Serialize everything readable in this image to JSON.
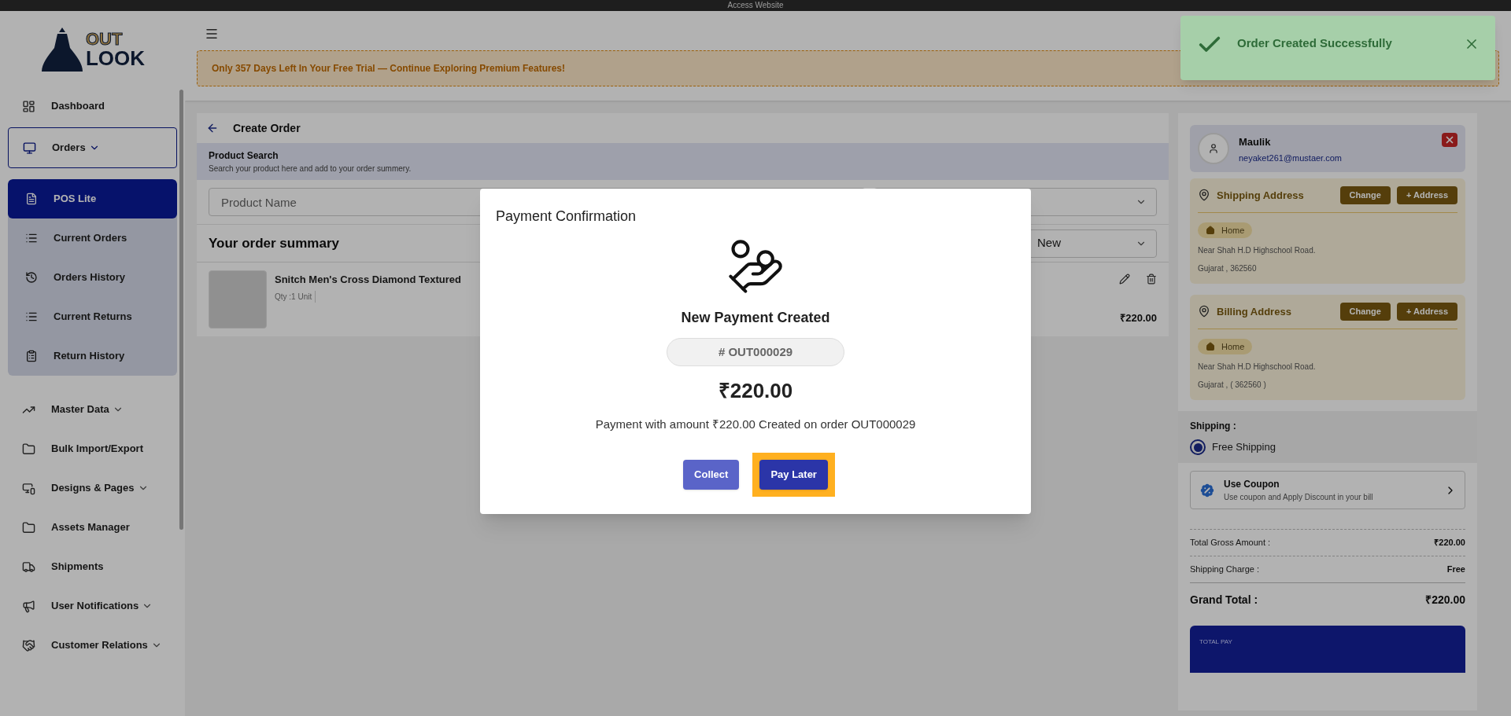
{
  "top_bar": {
    "title": "Access Website"
  },
  "sidebar": {
    "logo": {
      "line_1": "OUT",
      "line_2": "LOOK"
    },
    "items": [
      {
        "label": "Dashboard"
      },
      {
        "label": "Orders",
        "expanded": true,
        "children": [
          {
            "label": "POS Lite",
            "selected": true
          },
          {
            "label": "Current Orders",
            "selected": false
          },
          {
            "label": "Orders History",
            "selected": false
          },
          {
            "label": "Current Returns",
            "selected": false
          },
          {
            "label": "Return History",
            "selected": false
          }
        ]
      },
      {
        "label": "Master Data",
        "expanded": false
      },
      {
        "label": "Bulk Import/Export"
      },
      {
        "label": "Designs & Pages",
        "expanded": false
      },
      {
        "label": "Assets Manager"
      },
      {
        "label": "Shipments"
      },
      {
        "label": "User Notifications",
        "expanded": false
      },
      {
        "label": "Customer Relations",
        "expanded": false
      }
    ]
  },
  "banner": {
    "text": "Only 357 Days Left In Your Free Trial — Continue Exploring Premium Features!"
  },
  "toast": {
    "text": "Order Created Successfully"
  },
  "create_order": {
    "title": "Create Order",
    "product_search": {
      "title": "Product Search",
      "subtitle": "Search your product here and add to your order summery.",
      "placeholder": "Product Name"
    },
    "summary": {
      "title": "Your order summary",
      "status": "New",
      "items": [
        {
          "name": "Snitch Men's Cross Diamond Textured",
          "qty": "Qty :1 Unit",
          "price": "₹220.00"
        }
      ]
    }
  },
  "customer": {
    "name": "Maulik",
    "email": "neyaket261@mustaer.com"
  },
  "addresses": [
    {
      "title": "Shipping Address",
      "buttons": [
        "Change",
        "+ Address"
      ],
      "tag": "Home",
      "lines": [
        "Near Shah H.D Highschool Road.",
        "Gujarat , 362560"
      ]
    },
    {
      "title": "Billing Address",
      "buttons": [
        "Change",
        "+ Address"
      ],
      "tag": "Home",
      "lines": [
        "Near Shah H.D Highschool Road.",
        "Gujarat , ( 362560 )"
      ]
    }
  ],
  "shipping": {
    "label": "Shipping :",
    "options": [
      {
        "label": "Free Shipping",
        "selected": true
      }
    ]
  },
  "coupon": {
    "title": "Use Coupon",
    "subtitle": "Use coupon and Apply Discount in your bill"
  },
  "totals": {
    "rows": [
      {
        "label": "Total Gross Amount :",
        "value": "₹220.00"
      },
      {
        "label": "Shipping Charge :",
        "value": "Free"
      }
    ],
    "grand_total": {
      "label": "Grand Total :",
      "value": "₹220.00"
    },
    "total_pay": "TOTAL PAY"
  },
  "modal": {
    "title": "Payment Confirmation",
    "heading": "New Payment Created",
    "order_no": "# OUT000029",
    "amount": "₹220.00",
    "message": "Payment with amount ₹220.00 Created on order OUT000029",
    "buttons": [
      {
        "label": "Collect",
        "kind": "secondary",
        "highlighted": false
      },
      {
        "label": "Pay Later",
        "kind": "primary",
        "highlighted": true
      }
    ]
  }
}
